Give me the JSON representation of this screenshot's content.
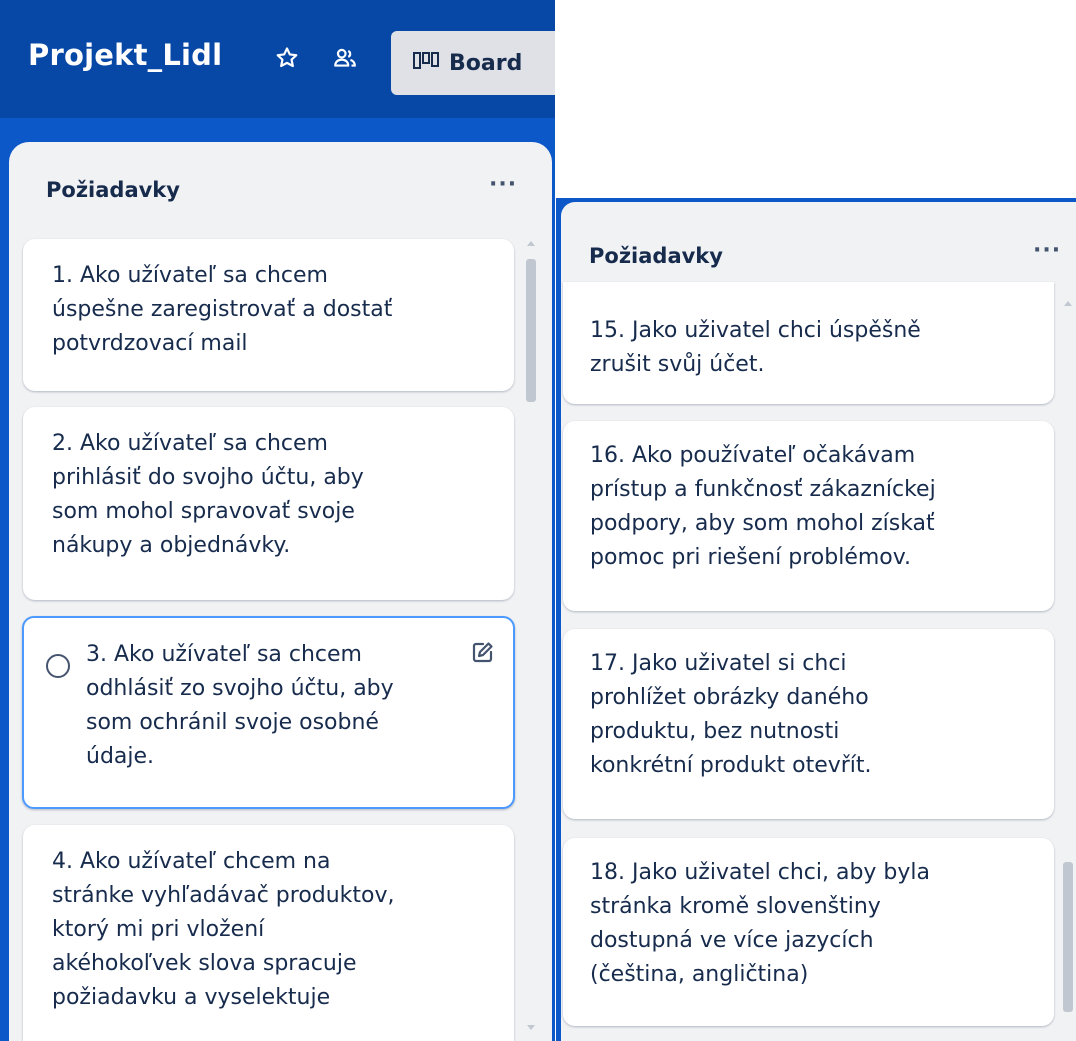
{
  "board": {
    "title": "Projekt_Lidl",
    "view_button_label": "Board",
    "icons": [
      "star-icon",
      "members-icon",
      "board-view-icon"
    ]
  },
  "lists": [
    {
      "title": "Požiadavky",
      "menu_label": "···",
      "cards": [
        {
          "lines": [
            "1. Ako užívateľ sa chcem",
            "úspešne zaregistrovať a dostať",
            "potvrdzovací mail"
          ]
        },
        {
          "lines": [
            "2. Ako užívateľ sa chcem",
            "prihlásiť do svojho účtu, aby",
            "som mohol spravovať svoje",
            "nákupy a objednávky."
          ]
        },
        {
          "lines": [
            "3. Ako užívateľ sa chcem",
            "odhlásiť zo svojho účtu, aby",
            "som ochránil svoje osobné",
            "údaje."
          ],
          "focused": true
        },
        {
          "lines": [
            "4. Ako užívateľ chcem na",
            "stránke vyhľadávač produktov,",
            "ktorý mi pri vložení",
            "akéhokoľvek slova spracuje",
            "požiadavku a vyselektuje"
          ]
        }
      ]
    },
    {
      "title": "Požiadavky",
      "menu_label": "···",
      "cards": [
        {
          "lines": [
            "15. Jako uživatel chci úspěšně",
            "zrušit svůj účet."
          ]
        },
        {
          "lines": [
            "16. Ako používateľ očakávam",
            "prístup a funkčnosť zákazníckej",
            "podpory, aby som mohol získať",
            "pomoc pri riešení problémov."
          ]
        },
        {
          "lines": [
            "17. Jako uživatel si chci",
            "prohlížet obrázky daného",
            "produktu, bez nutnosti",
            "konkrétní produkt otevřít."
          ]
        },
        {
          "lines": [
            "18. Jako uživatel chci, aby byla",
            "stránka kromě slovenštiny",
            "dostupná ve více jazycích",
            "(čeština, angličtina)"
          ]
        }
      ]
    }
  ]
}
